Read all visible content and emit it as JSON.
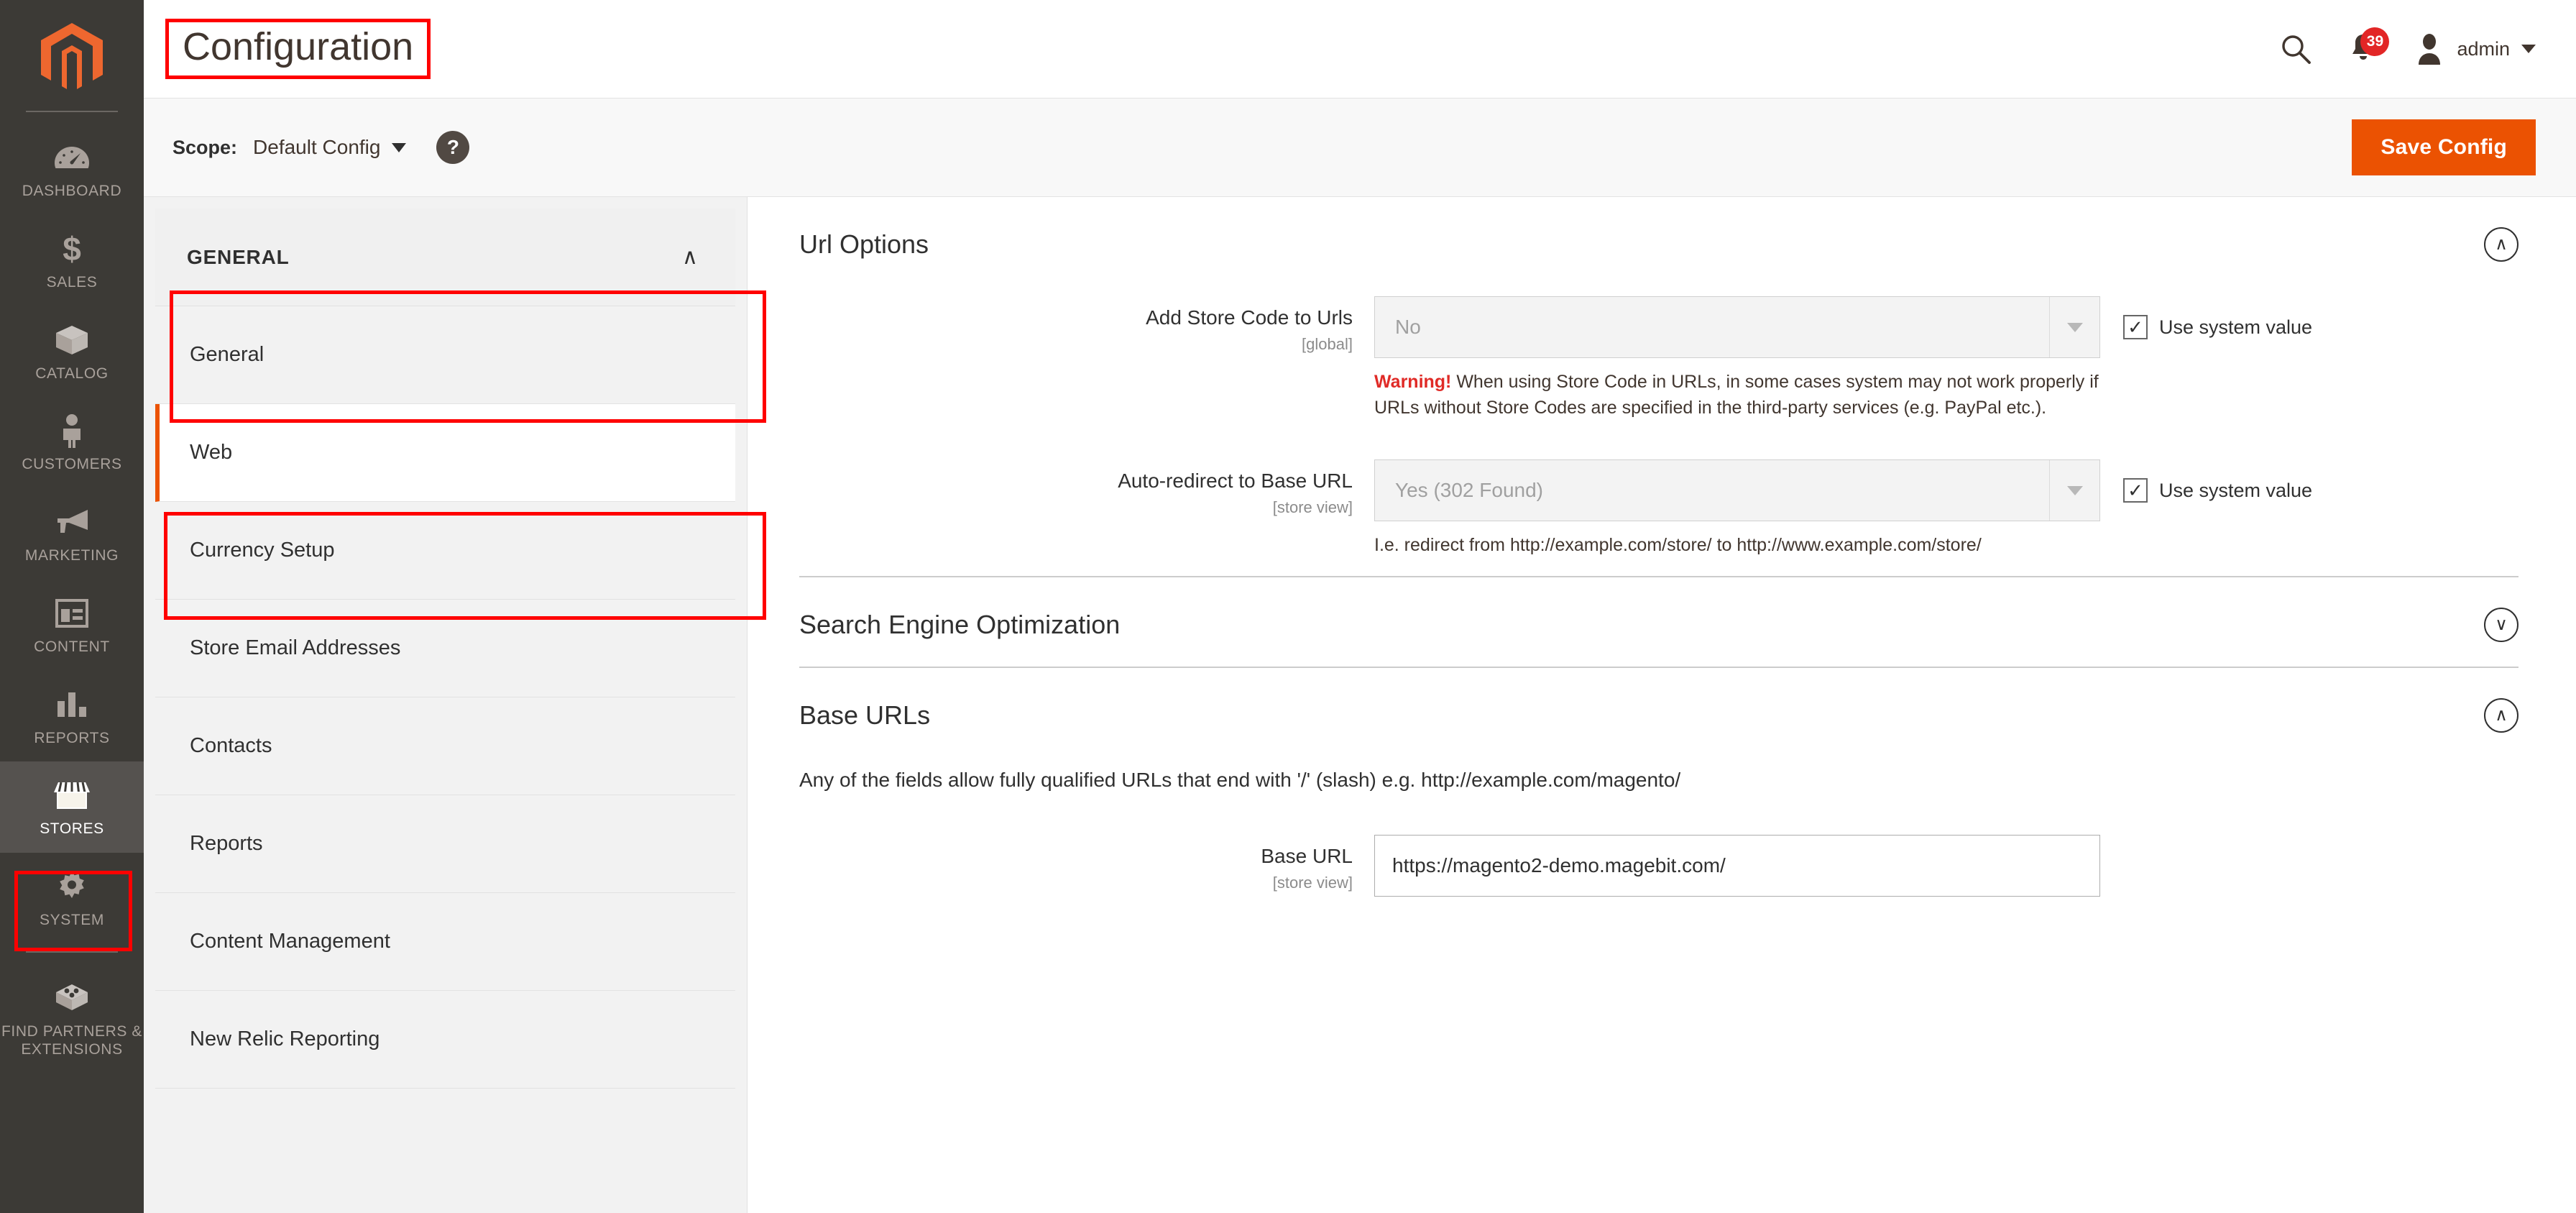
{
  "app": {
    "logo_icon": "magento-logo-icon"
  },
  "sidebar": {
    "items": [
      {
        "label": "DASHBOARD",
        "icon": "gauge-icon",
        "active": false
      },
      {
        "label": "SALES",
        "icon": "dollar-icon",
        "active": false
      },
      {
        "label": "CATALOG",
        "icon": "box-icon",
        "active": false
      },
      {
        "label": "CUSTOMERS",
        "icon": "person-icon",
        "active": false
      },
      {
        "label": "MARKETING",
        "icon": "megaphone-icon",
        "active": false
      },
      {
        "label": "CONTENT",
        "icon": "layout-icon",
        "active": false
      },
      {
        "label": "REPORTS",
        "icon": "bar-chart-icon",
        "active": false
      },
      {
        "label": "STORES",
        "icon": "storefront-icon",
        "active": true
      },
      {
        "label": "SYSTEM",
        "icon": "gear-icon",
        "active": false
      },
      {
        "label": "FIND PARTNERS & EXTENSIONS",
        "icon": "extension-box-icon",
        "active": false
      }
    ]
  },
  "header": {
    "title": "Configuration",
    "search_icon": "search-icon",
    "notifications_icon": "bell-icon",
    "notifications_count": "39",
    "user_icon": "user-avatar-icon",
    "user_name": "admin",
    "user_caret_icon": "chevron-down-icon"
  },
  "scope_bar": {
    "label": "Scope:",
    "selected": "Default Config",
    "caret_icon": "chevron-down-icon",
    "help_icon": "question-mark-icon",
    "help_glyph": "?",
    "save_label": "Save Config"
  },
  "config_nav": {
    "section_title": "GENERAL",
    "section_chevron": "chevron-up-icon",
    "section_chevron_glyph": "∧",
    "items": [
      {
        "label": "General",
        "active": false
      },
      {
        "label": "Web",
        "active": true
      },
      {
        "label": "Currency Setup",
        "active": false
      },
      {
        "label": "Store Email Addresses",
        "active": false
      },
      {
        "label": "Contacts",
        "active": false
      },
      {
        "label": "Reports",
        "active": false
      },
      {
        "label": "Content Management",
        "active": false
      },
      {
        "label": "New Relic Reporting",
        "active": false
      }
    ]
  },
  "content": {
    "url_options": {
      "title": "Url Options",
      "chevron_icon": "chevron-up-circle-icon",
      "chevron_glyph": "∧",
      "fields": [
        {
          "label": "Add Store Code to Urls",
          "scope": "[global]",
          "value": "No",
          "arrow_icon": "chevron-down-icon",
          "use_system_value": "Use system value",
          "checked_glyph": "✓",
          "note_strong": "Warning!",
          "note": " When using Store Code in URLs, in some cases system may not work properly if URLs without Store Codes are specified in the third-party services (e.g. PayPal etc.)."
        },
        {
          "label": "Auto-redirect to Base URL",
          "scope": "[store view]",
          "value": "Yes (302 Found)",
          "arrow_icon": "chevron-down-icon",
          "use_system_value": "Use system value",
          "checked_glyph": "✓",
          "note_strong": "",
          "note": "I.e. redirect from http://example.com/store/ to http://www.example.com/store/"
        }
      ]
    },
    "seo": {
      "title": "Search Engine Optimization",
      "chevron_icon": "chevron-down-circle-icon",
      "chevron_glyph": "∨"
    },
    "base_urls": {
      "title": "Base URLs",
      "chevron_icon": "chevron-up-circle-icon",
      "chevron_glyph": "∧",
      "intro": "Any of the fields allow fully qualified URLs that end with '/' (slash) e.g. http://example.com/magento/",
      "field": {
        "label": "Base URL",
        "scope": "[store view]",
        "value": "https://magento2-demo.magebit.com/"
      }
    }
  },
  "annotations": {
    "color": "#ff0000",
    "boxes": [
      "page-title",
      "general-section-header",
      "web-nav-item",
      "stores-sidebar-item"
    ]
  }
}
